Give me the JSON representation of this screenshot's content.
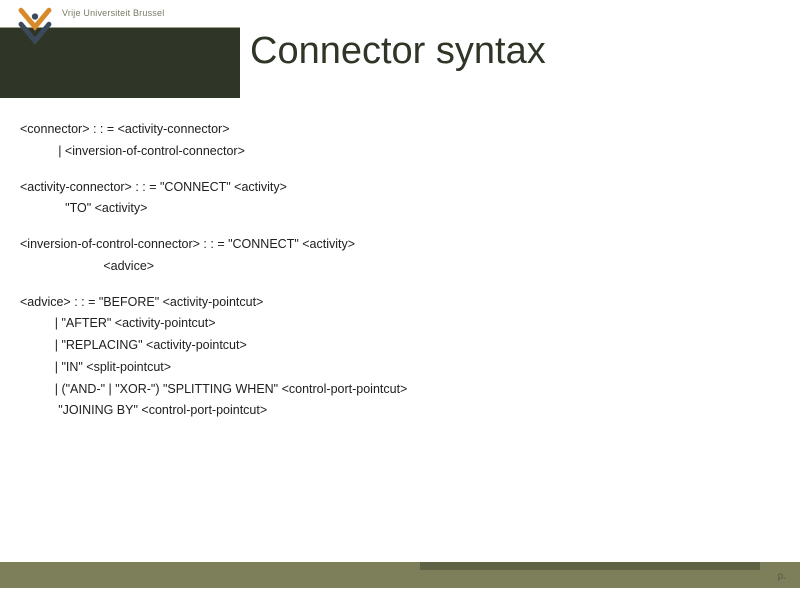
{
  "header": {
    "university": "Vrije Universiteit Brussel"
  },
  "title": "Connector syntax",
  "grammar": {
    "l1": "<connector> : : = <activity-connector>",
    "l2": "           | <inversion-of-control-connector>",
    "l3": "<activity-connector> : : = \"CONNECT\" <activity>",
    "l4": "             \"TO\" <activity>",
    "l5": "<inversion-of-control-connector> : : = \"CONNECT\" <activity>",
    "l6": "                        <advice>",
    "l7": "<advice> : : = \"BEFORE\" <activity-pointcut>",
    "l8": "          | \"AFTER\" <activity-pointcut>",
    "l9": "          | \"REPLACING\" <activity-pointcut>",
    "l10": "          | \"IN\" <split-pointcut>",
    "l11": "          | (\"AND-\" | \"XOR-\") \"SPLITTING WHEN\" <control-port-pointcut>",
    "l12": "           \"JOINING BY\" <control-port-pointcut>"
  },
  "footer": {
    "page_label": "p."
  }
}
